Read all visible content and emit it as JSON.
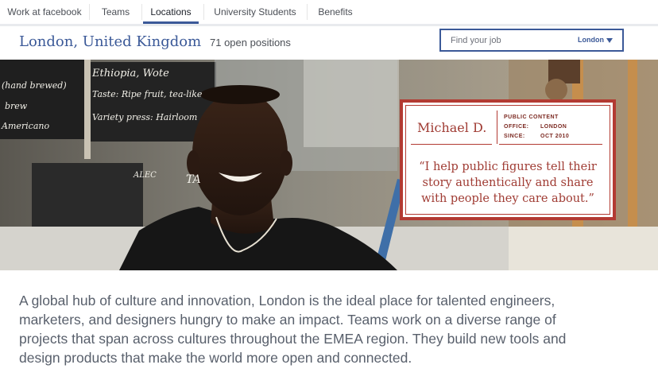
{
  "nav": {
    "items": [
      {
        "label": "Work at facebook"
      },
      {
        "label": "Teams"
      },
      {
        "label": "Locations"
      },
      {
        "label": "University Students"
      },
      {
        "label": "Benefits"
      }
    ],
    "active": "Locations"
  },
  "header": {
    "location": "London, United Kingdom",
    "positions": "71 open positions",
    "search": {
      "placeholder": "Find your job",
      "location_filter": "London"
    }
  },
  "hero": {
    "chalkboard": [
      "Ethiopia, Wote",
      "Taste: Ripe fruit, tea-like",
      "Variety press: Hairloom",
      "(hand brewed)",
      "brew",
      "Americano",
      "ALEC",
      "TA"
    ]
  },
  "profile": {
    "name": "Michael D.",
    "team": "PUBLIC CONTENT",
    "office_label": "OFFICE:",
    "office": "LONDON",
    "since_label": "SINCE:",
    "since": "OCT 2010",
    "quote": "“I help public figures tell their story authentically and share with people they care about.”"
  },
  "description": "A global hub of culture and innovation, London is the ideal place for talented engineers, marketers, and designers hungry to make an impact. Teams work on a diverse range of projects that span across cultures throughout the EMEA region. They build new tools and design products that make the world more open and connected.",
  "colors": {
    "brand": "#3b5998",
    "accent": "#b33a32"
  }
}
